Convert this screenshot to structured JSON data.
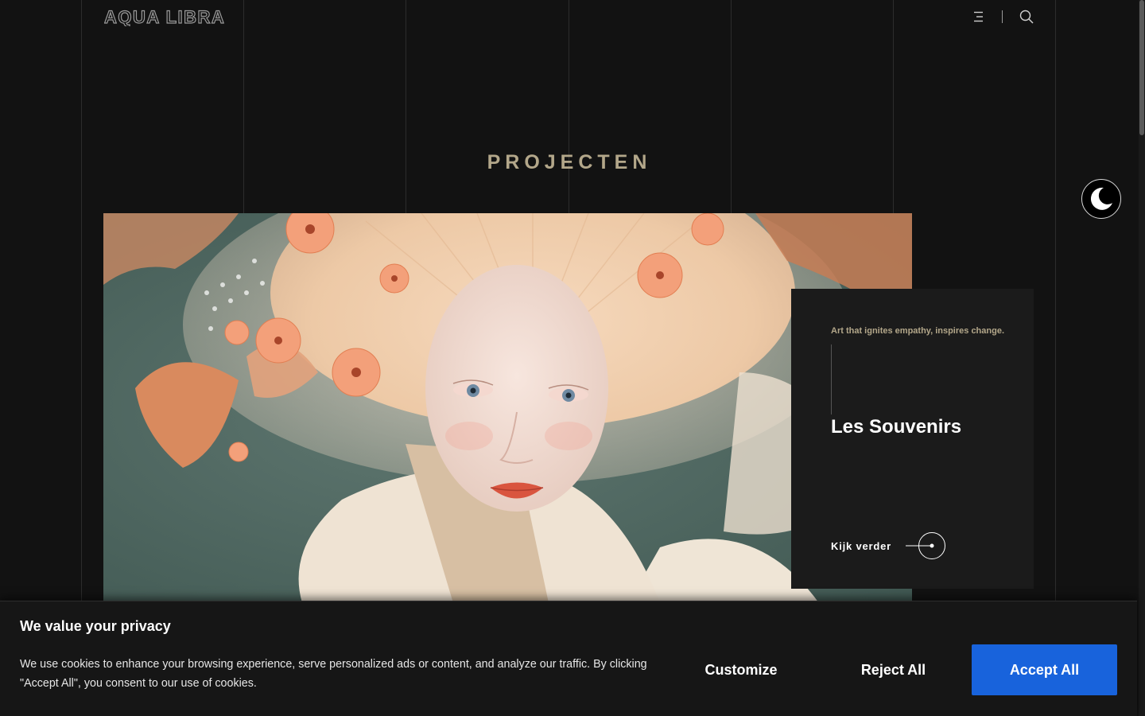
{
  "header": {
    "logo_text": "AQUA LIBRA",
    "menu_icon": "menu-icon",
    "search_icon": "search-icon"
  },
  "page": {
    "title": "PROJECTEN"
  },
  "theme_toggle": {
    "icon": "moon-icon"
  },
  "project_card": {
    "tagline": "Art that ignites empathy, inspires change.",
    "title": "Les Souvenirs",
    "link_label": "Kijk verder",
    "link_icon": "arrow-circle-icon"
  },
  "cookie_banner": {
    "title": "We value your privacy",
    "text": "We use cookies to enhance your browsing experience, serve personalized ads or content, and analyze our traffic. By clicking \"Accept All\", you consent to our use of cookies.",
    "customize_label": "Customize",
    "reject_label": "Reject All",
    "accept_label": "Accept All"
  },
  "colors": {
    "background": "#121212",
    "accent_gold": "#b3a78a",
    "card_bg": "#1b1b1b",
    "accept_blue": "#1863dc"
  }
}
